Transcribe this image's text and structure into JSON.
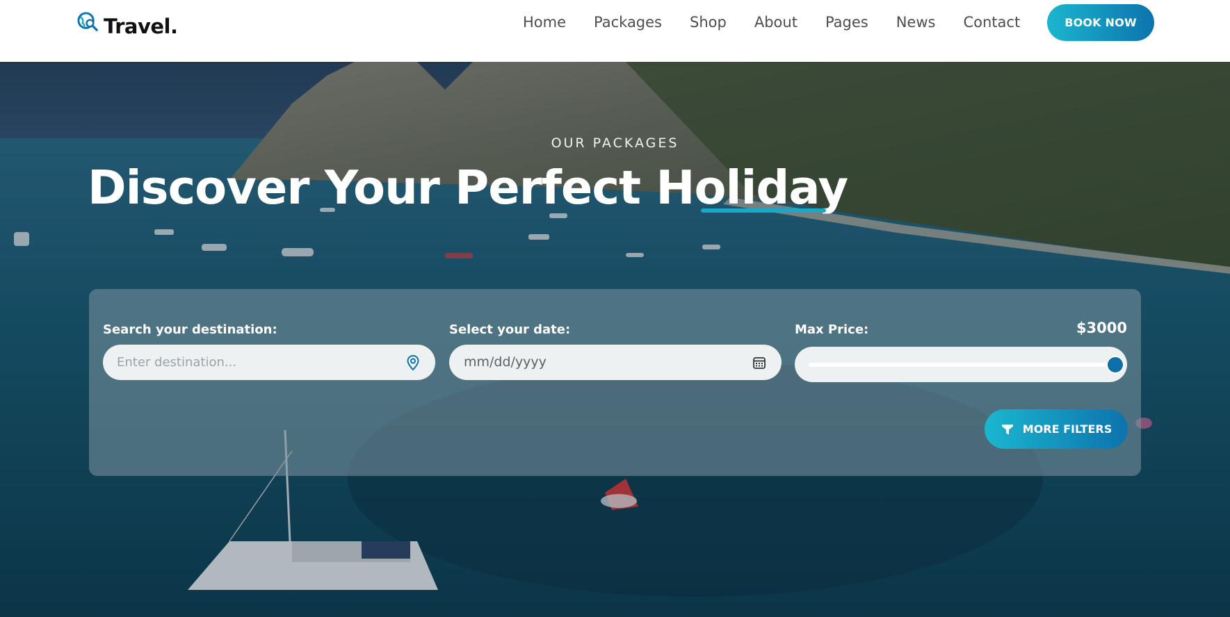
{
  "brand": {
    "name": "Travel.",
    "logo_icon": "globe-search-icon"
  },
  "nav": {
    "items": [
      {
        "label": "Home"
      },
      {
        "label": "Packages"
      },
      {
        "label": "Shop"
      },
      {
        "label": "About"
      },
      {
        "label": "Pages"
      },
      {
        "label": "News"
      },
      {
        "label": "Contact"
      }
    ],
    "cta_label": "BOOK NOW"
  },
  "hero": {
    "eyebrow": "OUR PACKAGES",
    "title": "Discover Your Perfect Holiday"
  },
  "search": {
    "destination": {
      "label": "Search your destination:",
      "placeholder": "Enter destination...",
      "icon": "location-pin-icon"
    },
    "date": {
      "label": "Select your date:",
      "value": "mm/dd/yyyy",
      "icon": "calendar-icon"
    },
    "price": {
      "label": "Max Price:",
      "value": "$3000",
      "slider_fraction": 1.0
    },
    "filters_label": "MORE FILTERS",
    "filters_icon": "filter-funnel-icon"
  },
  "colors": {
    "accent_start": "#1bb6cf",
    "accent_end": "#0d73ad",
    "underline": "#1aa7c8",
    "slider_thumb": "#0f6fa8"
  }
}
